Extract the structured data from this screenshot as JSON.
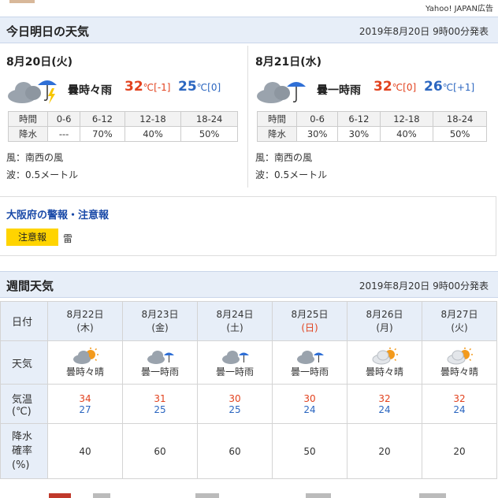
{
  "ad": {
    "label": "Yahoo! JAPAN広告"
  },
  "today_tomorrow": {
    "title": "今日明日の天気",
    "published": "2019年8月20日 9時00分発表",
    "days": [
      {
        "date": "8月20日(火)",
        "weather": "曇時々雨",
        "icon": "cloud-rain-thunder-icon",
        "high": "32",
        "high_diff": "[-1]",
        "low": "25",
        "low_diff": "[0]",
        "precip_header": [
          "時間",
          "0-6",
          "6-12",
          "12-18",
          "18-24"
        ],
        "precip_row": [
          "降水",
          "---",
          "70%",
          "40%",
          "50%"
        ],
        "wind": "風：南西の風",
        "wave": "波：0.5メートル"
      },
      {
        "date": "8月21日(水)",
        "weather": "曇一時雨",
        "icon": "cloud-umbrella-icon",
        "high": "32",
        "high_diff": "[0]",
        "low": "26",
        "low_diff": "[+1]",
        "precip_header": [
          "時間",
          "0-6",
          "6-12",
          "12-18",
          "18-24"
        ],
        "precip_row": [
          "降水",
          "30%",
          "30%",
          "40%",
          "50%"
        ],
        "wind": "風：南西の風",
        "wave": "波：0.5メートル"
      }
    ],
    "temp_unit": "℃"
  },
  "warnings": {
    "title": "大阪府の警報・注意報",
    "badge": "注意報",
    "item": "雷"
  },
  "weekly": {
    "title": "週間天気",
    "published": "2019年8月20日 9時00分発表",
    "row_labels": {
      "date": "日付",
      "weather": "天気",
      "temp": "気温",
      "temp_unit": "(℃)",
      "precip_1": "降水",
      "precip_2": "確率",
      "precip_3": "(%)"
    },
    "days": [
      {
        "date": "8月22日",
        "dow": "(木)",
        "weather": "曇時々晴",
        "icon": "cloud-sun-icon",
        "high": "34",
        "low": "27",
        "precip": "40"
      },
      {
        "date": "8月23日",
        "dow": "(金)",
        "weather": "曇一時雨",
        "icon": "cloud-umbrella-icon",
        "high": "31",
        "low": "25",
        "precip": "60"
      },
      {
        "date": "8月24日",
        "dow": "(土)",
        "weather": "曇一時雨",
        "icon": "cloud-umbrella-icon",
        "high": "30",
        "low": "25",
        "precip": "60"
      },
      {
        "date": "8月25日",
        "dow": "(日)",
        "weather": "曇一時雨",
        "icon": "cloud-umbrella-icon",
        "high": "30",
        "low": "24",
        "precip": "50"
      },
      {
        "date": "8月26日",
        "dow": "(月)",
        "weather": "曇時々晴",
        "icon": "cloud-sun-icon",
        "high": "32",
        "low": "24",
        "precip": "20"
      },
      {
        "date": "8月27日",
        "dow": "(火)",
        "weather": "曇時々晴",
        "icon": "cloud-sun-icon",
        "high": "32",
        "low": "24",
        "precip": "20"
      }
    ]
  },
  "colors": {
    "high": "#e2421e",
    "low": "#2b66c0",
    "header_bg": "#e7eef8",
    "badge": "#ffd400",
    "link": "#1a4aa8"
  }
}
